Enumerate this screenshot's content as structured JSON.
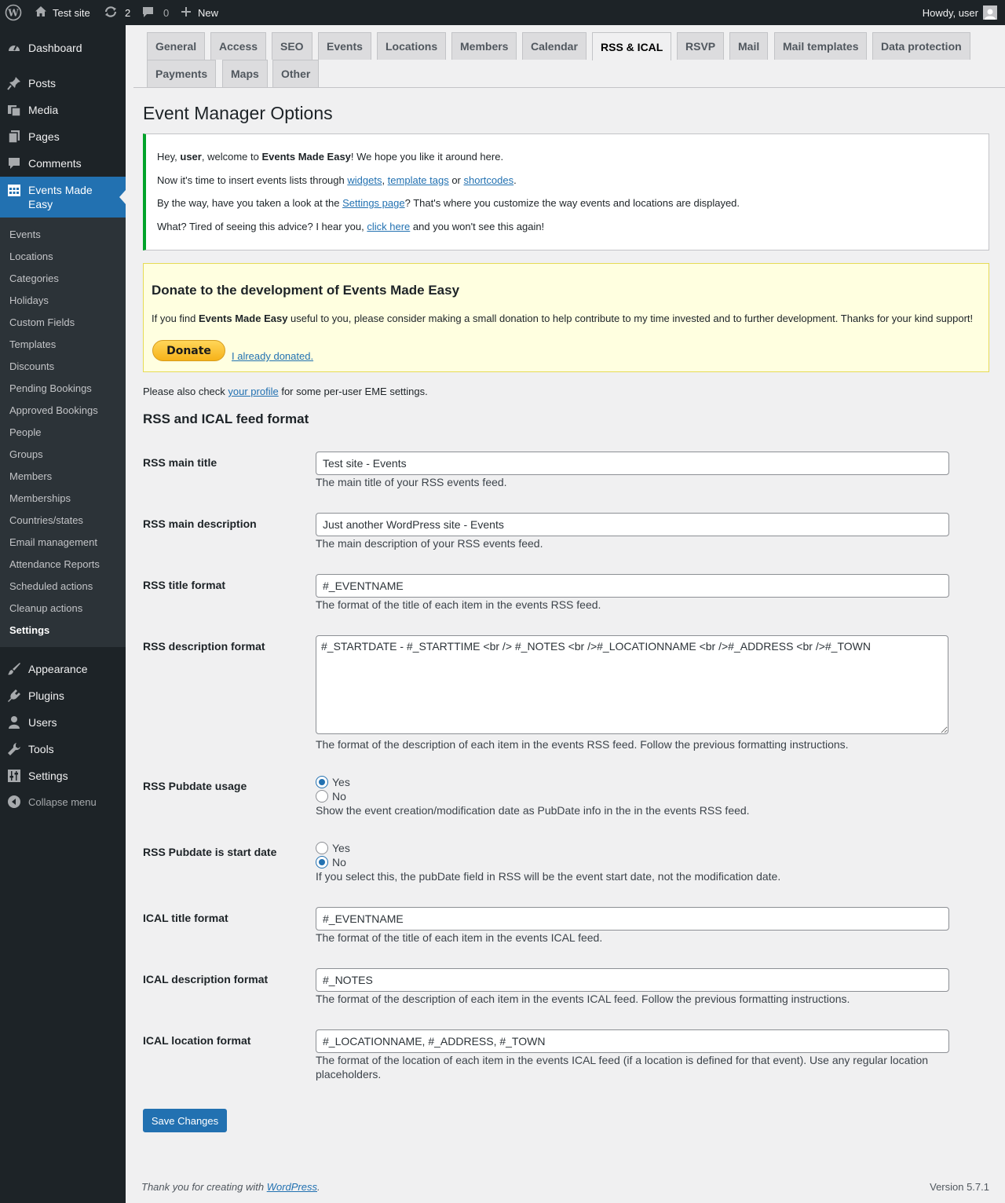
{
  "admin_bar": {
    "site_name": "Test site",
    "updates_count": "2",
    "comments_count": "0",
    "new_label": "New",
    "howdy": "Howdy, user"
  },
  "menu": {
    "dashboard": "Dashboard",
    "posts": "Posts",
    "media": "Media",
    "pages": "Pages",
    "comments": "Comments",
    "events_made_easy_1": "Events Made",
    "events_made_easy_2": "Easy",
    "appearance": "Appearance",
    "plugins": "Plugins",
    "users": "Users",
    "tools": "Tools",
    "settings": "Settings",
    "collapse": "Collapse menu"
  },
  "submenu": [
    "Events",
    "Locations",
    "Categories",
    "Holidays",
    "Custom Fields",
    "Templates",
    "Discounts",
    "Pending Bookings",
    "Approved Bookings",
    "People",
    "Groups",
    "Members",
    "Memberships",
    "Countries/states",
    "Email management",
    "Attendance Reports",
    "Scheduled actions",
    "Cleanup actions",
    "Settings"
  ],
  "tabs": [
    "General",
    "Access",
    "SEO",
    "Events",
    "Locations",
    "Members",
    "Calendar",
    "RSS & ICAL",
    "RSVP",
    "Mail",
    "Mail templates",
    "Data protection",
    "Payments",
    "Maps",
    "Other"
  ],
  "active_tab": "RSS & ICAL",
  "page_title": "Event Manager Options",
  "notice": {
    "l1_a": "Hey, ",
    "l1_user": "user",
    "l1_b": ", welcome to ",
    "l1_plugin": "Events Made Easy",
    "l1_c": "! We hope you like it around here.",
    "l2_a": "Now it's time to insert events lists through ",
    "l2_widgets": "widgets",
    "l2_b": ", ",
    "l2_tags": "template tags",
    "l2_c": " or ",
    "l2_shortcodes": "shortcodes",
    "l2_d": ".",
    "l3_a": "By the way, have you taken a look at the ",
    "l3_link": "Settings page",
    "l3_b": "? That's where you customize the way events and locations are displayed.",
    "l4_a": "What? Tired of seeing this advice? I hear you, ",
    "l4_link": "click here",
    "l4_b": " and you won't see this again!"
  },
  "donate": {
    "title": "Donate to the development of Events Made Easy",
    "text_a": "If you find ",
    "text_plugin": "Events Made Easy",
    "text_b": " useful to you, please consider making a small donation to help contribute to my time invested and to further development. Thanks for your kind support!",
    "button": "Donate",
    "already": "I already donated."
  },
  "profile_note": {
    "a": "Please also check ",
    "link": "your profile",
    "b": " for some per-user EME settings."
  },
  "section_title": "RSS and ICAL feed format",
  "fields": {
    "rss_main_title": {
      "label": "RSS main title",
      "value": "Test site - Events",
      "desc": "The main title of your RSS events feed."
    },
    "rss_main_desc": {
      "label": "RSS main description",
      "value": "Just another WordPress site - Events",
      "desc": "The main description of your RSS events feed."
    },
    "rss_title_format": {
      "label": "RSS title format",
      "value": "#_EVENTNAME",
      "desc": "The format of the title of each item in the events RSS feed."
    },
    "rss_desc_format": {
      "label": "RSS description format",
      "value": "#_STARTDATE - #_STARTTIME <br /> #_NOTES <br />#_LOCATIONNAME <br />#_ADDRESS <br />#_TOWN",
      "desc": "The format of the description of each item in the events RSS feed. Follow the previous formatting instructions."
    },
    "rss_pubdate_usage": {
      "label": "RSS Pubdate usage",
      "yes": "Yes",
      "no": "No",
      "selected": "Yes",
      "desc": "Show the event creation/modification date as PubDate info in the in the events RSS feed."
    },
    "rss_pubdate_start": {
      "label": "RSS Pubdate is start date",
      "yes": "Yes",
      "no": "No",
      "selected": "No",
      "desc": "If you select this, the pubDate field in RSS will be the event start date, not the modification date."
    },
    "ical_title_format": {
      "label": "ICAL title format",
      "value": "#_EVENTNAME",
      "desc": "The format of the title of each item in the events ICAL feed."
    },
    "ical_desc_format": {
      "label": "ICAL description format",
      "value": "#_NOTES",
      "desc": "The format of the description of each item in the events ICAL feed. Follow the previous formatting instructions."
    },
    "ical_location_format": {
      "label": "ICAL location format",
      "value": "#_LOCATIONNAME, #_ADDRESS, #_TOWN",
      "desc_1": "The format of the location of each item in the events ICAL feed (if a location is defined for that event). Use any regular location",
      "desc_2": "placeholders."
    }
  },
  "save_button": "Save Changes",
  "footer": {
    "a": "Thank you for creating with ",
    "link": "WordPress",
    "b": ".",
    "version": "Version 5.7.1"
  },
  "colors": {
    "accent": "#2271b1",
    "sidebar": "#1d2327",
    "submenu": "#2c3338",
    "notice_border": "#00a32a",
    "donate_bg": "#ffffe0"
  }
}
